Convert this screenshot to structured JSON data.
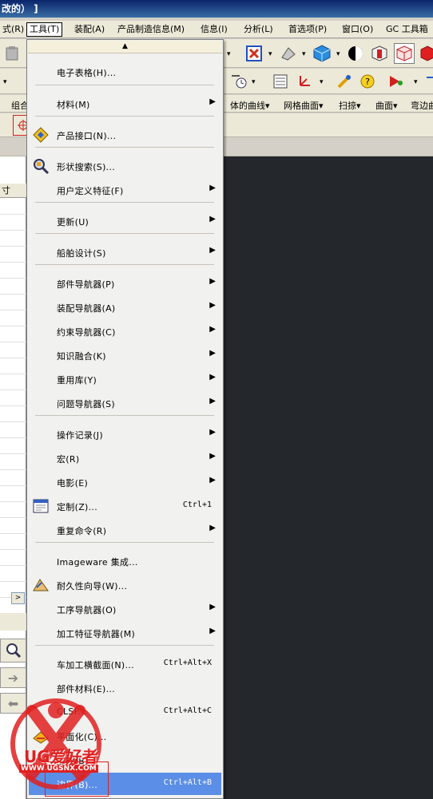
{
  "window": {
    "title": "改的） ]"
  },
  "menubar": {
    "items": [
      {
        "label": "式(R)"
      },
      {
        "label": "工具(T)"
      },
      {
        "label": "装配(A)"
      },
      {
        "label": "产品制造信息(M)"
      },
      {
        "label": "信息(I)"
      },
      {
        "label": "分析(L)"
      },
      {
        "label": "首选项(P)"
      },
      {
        "label": "窗口(O)"
      },
      {
        "label": "GC 工具箱"
      }
    ]
  },
  "toolbar_labels": {
    "left": "组合",
    "items": [
      "体的曲线▾",
      "网格曲面▾",
      "扫掠▾",
      "曲面▾",
      "弯边曲"
    ]
  },
  "left_panel": {
    "header": "寸"
  },
  "tools_menu": {
    "scroll_up": "▲",
    "items": [
      {
        "label": "电子表格(H)...",
        "shortcut": "",
        "submenu": false,
        "icon": ""
      },
      {
        "label": "材料(M)",
        "shortcut": "",
        "submenu": true,
        "icon": ""
      },
      {
        "label": "产品接口(N)...",
        "shortcut": "",
        "submenu": false,
        "icon": "product-interface-icon"
      },
      {
        "label": "形状搜索(S)...",
        "shortcut": "",
        "submenu": false,
        "icon": "shape-search-icon"
      },
      {
        "label": "用户定义特征(F)",
        "shortcut": "",
        "submenu": true,
        "icon": ""
      },
      {
        "label": "更新(U)",
        "shortcut": "",
        "submenu": true,
        "icon": ""
      },
      {
        "label": "船舶设计(S)",
        "shortcut": "",
        "submenu": true,
        "icon": ""
      },
      {
        "label": "部件导航器(P)",
        "shortcut": "",
        "submenu": true,
        "icon": ""
      },
      {
        "label": "装配导航器(A)",
        "shortcut": "",
        "submenu": true,
        "icon": ""
      },
      {
        "label": "约束导航器(C)",
        "shortcut": "",
        "submenu": true,
        "icon": ""
      },
      {
        "label": "知识融合(K)",
        "shortcut": "",
        "submenu": true,
        "icon": ""
      },
      {
        "label": "重用库(Y)",
        "shortcut": "",
        "submenu": true,
        "icon": ""
      },
      {
        "label": "问题导航器(S)",
        "shortcut": "",
        "submenu": true,
        "icon": ""
      },
      {
        "label": "操作记录(J)",
        "shortcut": "",
        "submenu": true,
        "icon": ""
      },
      {
        "label": "宏(R)",
        "shortcut": "",
        "submenu": true,
        "icon": ""
      },
      {
        "label": "电影(E)",
        "shortcut": "",
        "submenu": true,
        "icon": ""
      },
      {
        "label": "定制(Z)...",
        "shortcut": "Ctrl+1",
        "submenu": false,
        "icon": "customize-icon"
      },
      {
        "label": "重复命令(R)",
        "shortcut": "",
        "submenu": true,
        "icon": ""
      },
      {
        "label": "Imageware 集成...",
        "shortcut": "",
        "submenu": false,
        "icon": ""
      },
      {
        "label": "耐久性向导(W)...",
        "shortcut": "",
        "submenu": false,
        "icon": "durability-wizard-icon"
      },
      {
        "label": "工序导航器(O)",
        "shortcut": "",
        "submenu": true,
        "icon": ""
      },
      {
        "label": "加工特征导航器(M)",
        "shortcut": "",
        "submenu": true,
        "icon": ""
      },
      {
        "label": "车加工横截面(N)...",
        "shortcut": "Ctrl+Alt+X",
        "submenu": false,
        "icon": ""
      },
      {
        "label": "部件材料(E)...",
        "shortcut": "",
        "submenu": false,
        "icon": ""
      },
      {
        "label": "CLSF...",
        "shortcut": "Ctrl+Alt+C",
        "submenu": false,
        "icon": ""
      },
      {
        "label": "平面化(C)...",
        "shortcut": "",
        "submenu": false,
        "icon": "flatten-icon"
      },
      {
        "label": "黑板(B)...",
        "shortcut": "",
        "submenu": false,
        "icon": ""
      },
      {
        "label": "边界(B)...",
        "shortcut": "Ctrl+Alt+B",
        "submenu": false,
        "icon": ""
      }
    ]
  },
  "watermark": {
    "brand": "UG爱好者",
    "url": "WWW.UGSNX.COM"
  }
}
